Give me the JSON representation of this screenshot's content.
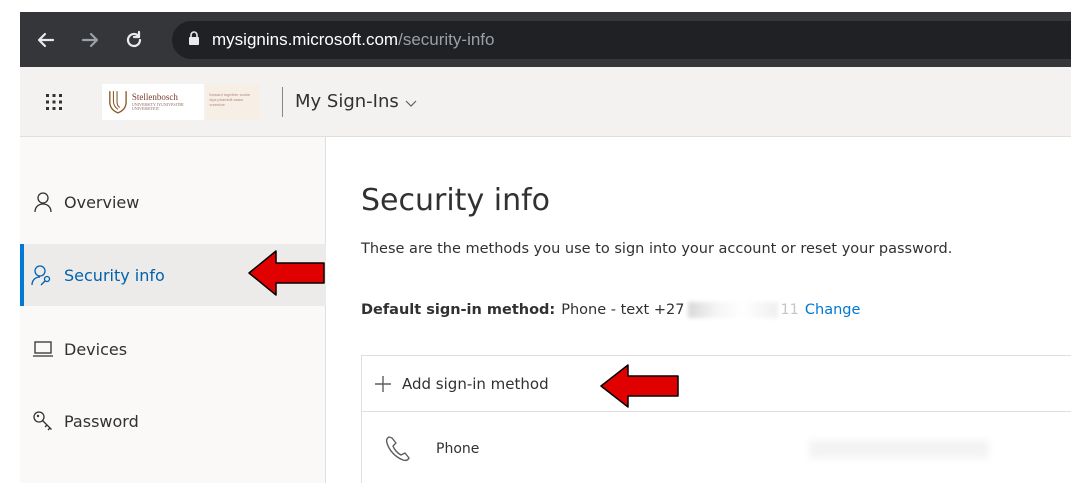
{
  "browser": {
    "url_host": "mysignins.microsoft.com",
    "url_path": "/security-info"
  },
  "header": {
    "logo_name": "Stellenbosch",
    "logo_sub": "UNIVERSITY IYUNIVESITHI UNIVERSITEIT",
    "logo_tagline": "forward together sonke siya phambili saam vorentoe",
    "app_title": "My Sign-Ins"
  },
  "sidebar": {
    "items": [
      {
        "label": "Overview",
        "icon": "person-icon"
      },
      {
        "label": "Security info",
        "icon": "person-key-icon"
      },
      {
        "label": "Devices",
        "icon": "laptop-icon"
      },
      {
        "label": "Password",
        "icon": "key-icon"
      }
    ]
  },
  "main": {
    "title": "Security info",
    "description": "These are the methods you use to sign into your account or reset your password.",
    "default_method_label": "Default sign-in method:",
    "default_method_value": "Phone - text +27",
    "phone_suffix": "11",
    "change_label": "Change",
    "add_method_label": "Add sign-in method",
    "methods": [
      {
        "label": "Phone",
        "icon": "phone-icon"
      }
    ]
  },
  "colors": {
    "accent": "#0078d4",
    "arrow": "#e00000"
  }
}
